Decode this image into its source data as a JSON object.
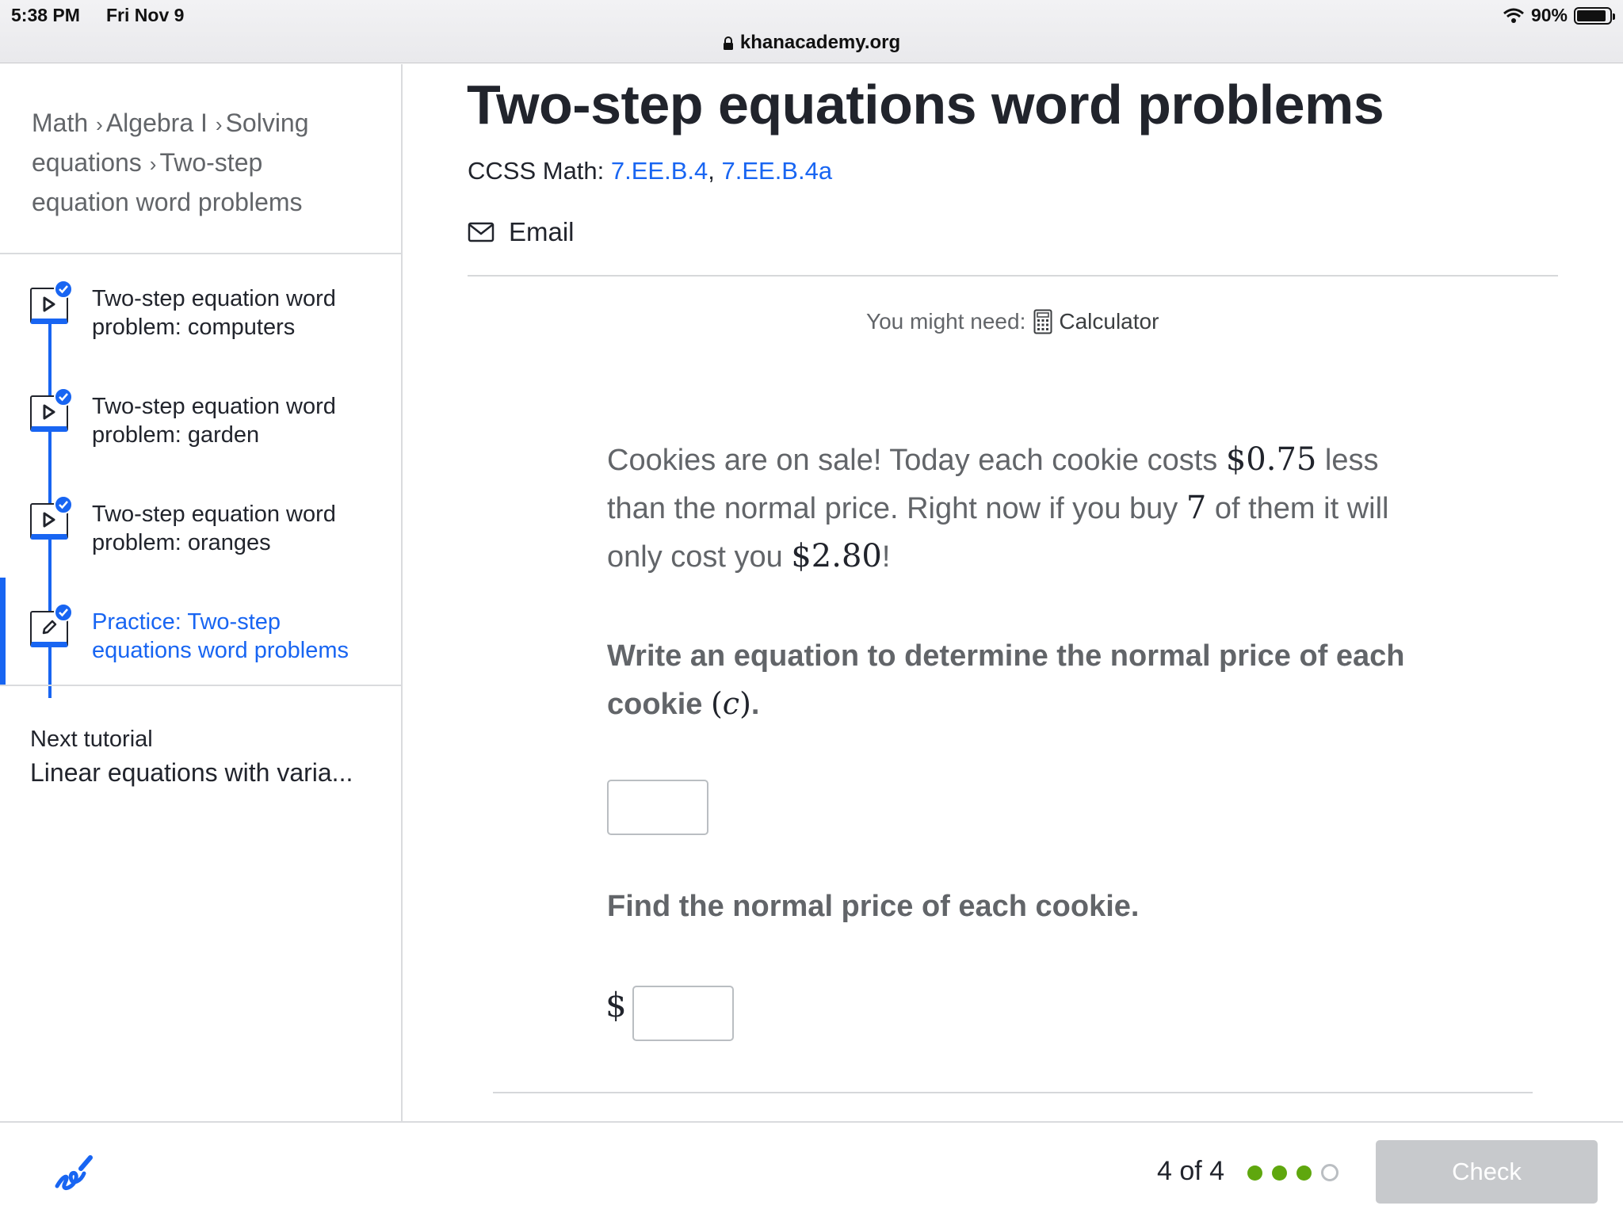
{
  "status_bar": {
    "time": "5:38 PM",
    "date": "Fri Nov 9",
    "battery": "90%",
    "battery_level": 0.9
  },
  "browser": {
    "url": "khanacademy.org"
  },
  "sidebar": {
    "breadcrumb": [
      "Math",
      "Algebra I",
      "Solving equations",
      "Two-step equation word problems"
    ],
    "lessons": [
      {
        "label": "Two-step equation word problem: computers",
        "type": "video",
        "completed": true
      },
      {
        "label": "Two-step equation word problem: garden",
        "type": "video",
        "completed": true
      },
      {
        "label": "Two-step equation word problem: oranges",
        "type": "video",
        "completed": true
      },
      {
        "label": "Practice: Two-step equations word problems",
        "type": "exercise",
        "completed": true,
        "active": true
      }
    ],
    "next_tutorial": {
      "label": "Next tutorial",
      "title": "Linear equations with varia..."
    }
  },
  "main": {
    "title": "Two-step equations word problems",
    "ccss_prefix": "CCSS Math: ",
    "ccss_links": [
      "7.EE.B.4",
      "7.EE.B.4a"
    ],
    "email_label": "Email",
    "might_need_label": "You might need:",
    "calculator_label": "Calculator",
    "problem": {
      "t1": "Cookies are on sale! Today each cookie costs ",
      "price_less": "$0.75",
      "t2": " less than the normal price. Right now if you buy ",
      "count": "7",
      "t3": " of them it will only cost you ",
      "total": "$2.80",
      "t4": "!"
    },
    "question": {
      "t1": "Write an equation to determine the normal price of each cookie ",
      "var_open": "(",
      "var": "c",
      "var_close": ")",
      "t2": "."
    },
    "find_label": "Find the normal price of each cookie.",
    "dollar_sign": "$"
  },
  "footer": {
    "counter": "4 of 4",
    "dots_filled": 3,
    "dots_total": 4,
    "check_label": "Check"
  },
  "colors": {
    "accent_blue": "#1865f2",
    "progress_green": "#5fa70e",
    "disabled_button": "#c7c9cc"
  }
}
